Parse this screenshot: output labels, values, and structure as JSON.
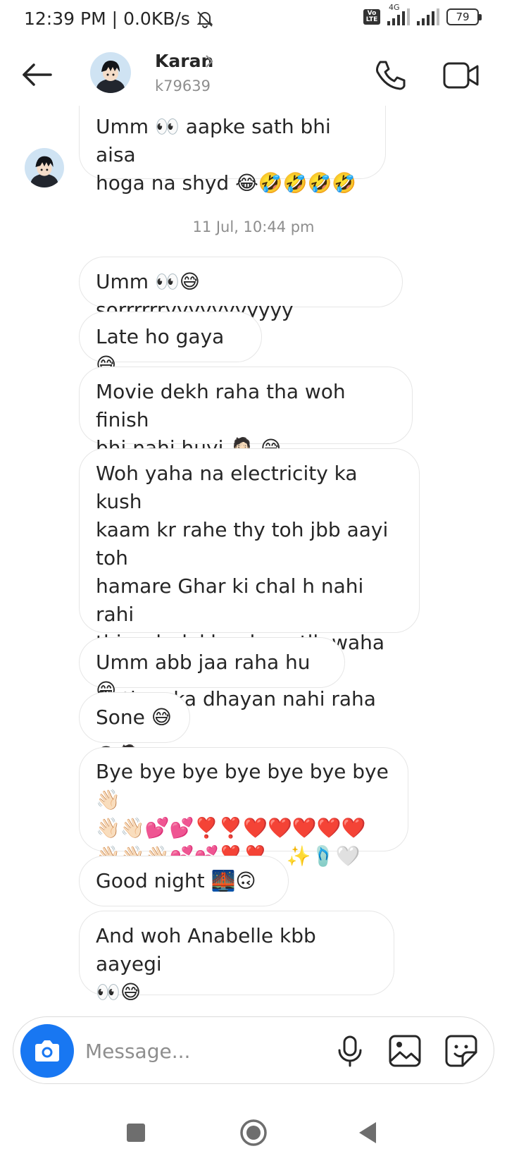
{
  "status": {
    "time": "12:39 PM",
    "separator": "|",
    "speed": "0.0KB/s",
    "volte": "Vo LTE",
    "network": "4G",
    "battery": "79"
  },
  "header": {
    "name": "Karan",
    "username": "k79639"
  },
  "messages": [
    {
      "text": "Umm 👀 aapke sath bhi aisa\nhoga na shyd 😂🤣🤣🤣🤣"
    },
    {
      "text": "Umm 👀😅 sorrrrrryyyyyyyyyyy"
    },
    {
      "text": "Late ho gaya 😅"
    },
    {
      "text": "Movie dekh raha tha woh finish\nbhi nahi huyi 🤦🏻 😅"
    },
    {
      "text": "Woh yaha na electricity ka kush\nkaam kr rahe thy toh jbb aayi toh\nhamare Ghar ki chal h nahi rahi\nthi woh dekh raha mtlb waha tha\nfir time ka dhayan nahi raha 👀\n😅🤦🏻 reels dekhne lagg gaya"
    },
    {
      "text": "Umm abb jaa raha hu 😁"
    },
    {
      "text": "Sone 😅"
    },
    {
      "text": "Bye bye bye bye bye bye bye 👋🏻\n👋🏻👋🏻💕💕❣️❣️❤️❤️❤️❤️❤️\n👋🏻👋🏻👋🏻💕💕❣️❣️.. ✨🩴🤍"
    },
    {
      "text": "Good night 🌉🙃 .."
    },
    {
      "text": "And woh Anabelle kbb aayegi\n👀😅"
    }
  ],
  "timestamp": "11 Jul, 10:44 pm",
  "composer": {
    "placeholder": "Message..."
  },
  "colors": {
    "accent": "#1877f2",
    "text": "#262626",
    "muted": "#8e8e8e",
    "bubble_border": "#e6e6e6"
  },
  "icons": [
    "back-arrow-icon",
    "chevron-right-icon",
    "phone-icon",
    "video-camera-icon",
    "camera-icon",
    "microphone-icon",
    "gallery-icon",
    "sticker-icon",
    "recents-icon",
    "home-icon",
    "back-icon"
  ]
}
